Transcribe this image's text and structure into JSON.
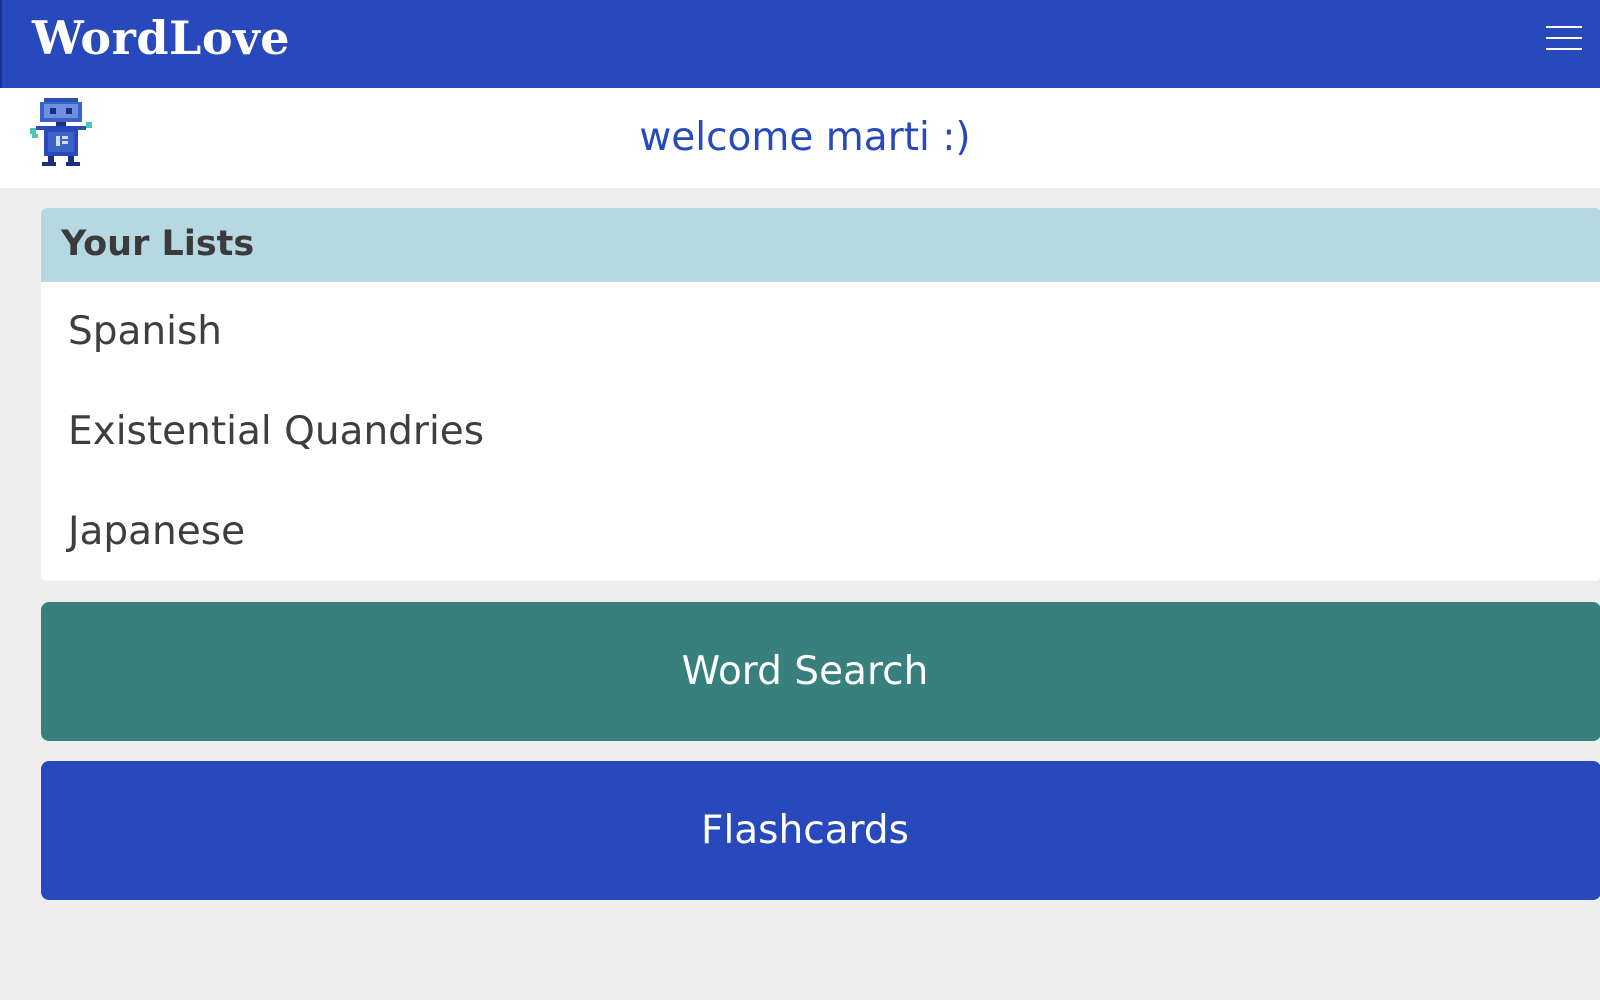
{
  "header": {
    "brand": "WordLove",
    "menu_icon": "hamburger-menu-icon",
    "color": "#2749bb"
  },
  "welcome": {
    "avatar_icon": "robot-icon",
    "text": "welcome marti :)"
  },
  "lists": {
    "title": "Your Lists",
    "items": [
      {
        "label": "Spanish"
      },
      {
        "label": "Existential Quandries"
      },
      {
        "label": "Japanese"
      }
    ]
  },
  "actions": {
    "word_search": {
      "label": "Word Search",
      "color": "#38807e"
    },
    "flashcards": {
      "label": "Flashcards",
      "color": "#2749bb"
    }
  }
}
